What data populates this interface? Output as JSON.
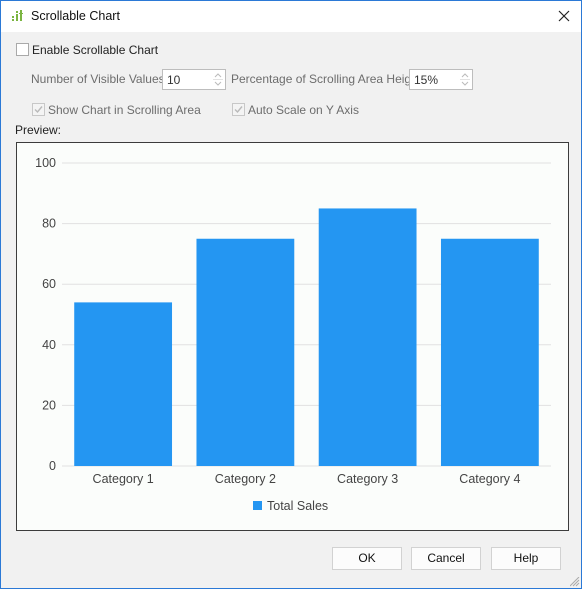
{
  "window": {
    "title": "Scrollable Chart",
    "icon": "bar-chart-icon",
    "close_icon": "close-icon"
  },
  "options": {
    "enable_scrollable": {
      "label": "Enable Scrollable Chart",
      "checked": false
    },
    "visible_values": {
      "label": "Number of Visible Values:",
      "value": "10"
    },
    "scroll_area_height": {
      "label": "Percentage of Scrolling Area Height:",
      "value": "15%"
    },
    "show_chart_in_scroll": {
      "label": "Show Chart in Scrolling Area",
      "checked": true,
      "disabled": true
    },
    "auto_scale_y": {
      "label": "Auto Scale on Y Axis",
      "checked": true,
      "disabled": true
    }
  },
  "preview_label": "Preview:",
  "colors": {
    "bar": "#2496f2",
    "accent_border": "#2b79d6"
  },
  "chart_data": {
    "type": "bar",
    "title": "",
    "xlabel": "",
    "ylabel": "",
    "categories": [
      "Category 1",
      "Category 2",
      "Category 3",
      "Category 4"
    ],
    "series": [
      {
        "name": "Total Sales",
        "values": [
          54,
          75,
          85,
          75
        ],
        "color": "#2496f2"
      }
    ],
    "ylim": [
      0,
      100
    ],
    "yticks": [
      0,
      20,
      40,
      60,
      80,
      100
    ],
    "grid": true,
    "legend": "bottom-center"
  },
  "buttons": {
    "ok": "OK",
    "cancel": "Cancel",
    "help": "Help"
  }
}
